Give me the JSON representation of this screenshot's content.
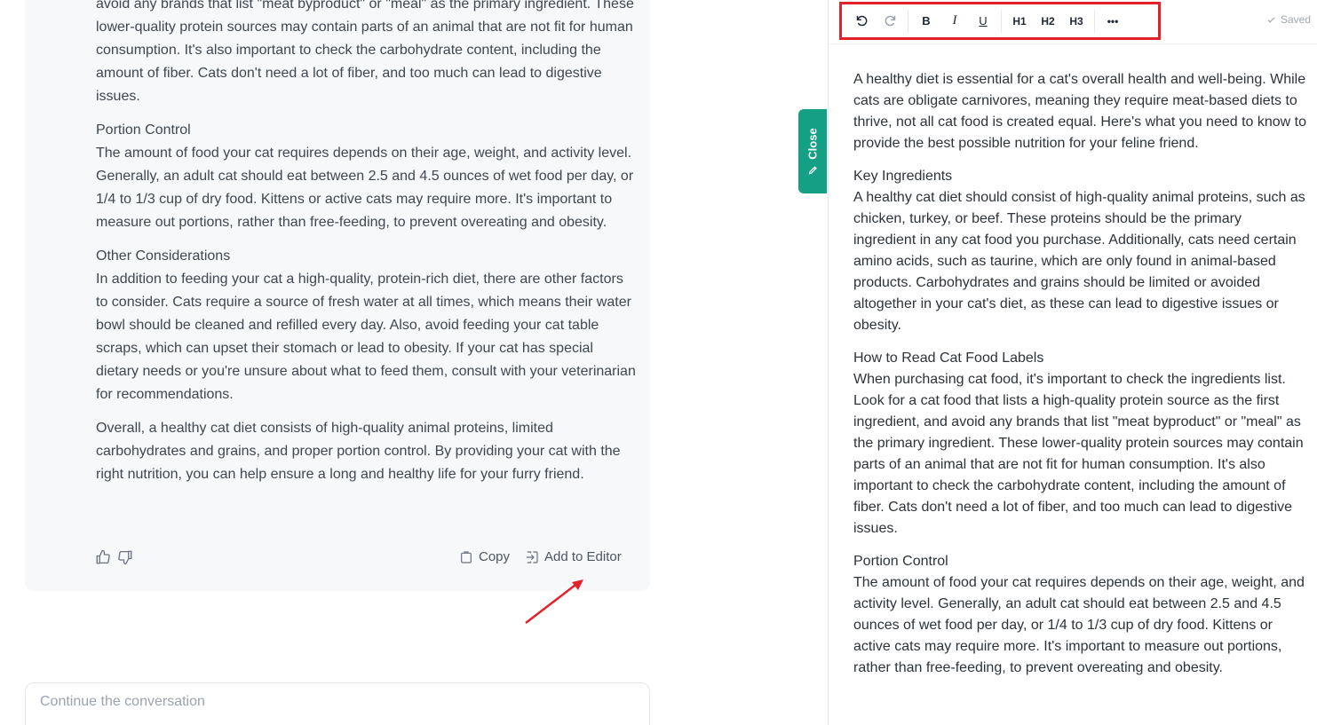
{
  "chat": {
    "paragraphs": [
      {
        "title": "",
        "text": "avoid any brands that list \"meat byproduct\" or \"meal\" as the primary ingredient. These lower-quality protein sources may contain parts of an animal that are not fit for human consumption. It's also important to check the carbohydrate content, including the amount of fiber. Cats don't need a lot of fiber, and too much can lead to digestive issues."
      },
      {
        "title": "Portion Control",
        "text": "The amount of food your cat requires depends on their age, weight, and activity level. Generally, an adult cat should eat between 2.5 and 4.5 ounces of wet food per day, or 1/4 to 1/3 cup of dry food. Kittens or active cats may require more. It's important to measure out portions, rather than free-feeding, to prevent overeating and obesity."
      },
      {
        "title": "Other Considerations",
        "text": "In addition to feeding your cat a high-quality, protein-rich diet, there are other factors to consider. Cats require a source of fresh water at all times, which means their water bowl should be cleaned and refilled every day. Also, avoid feeding your cat table scraps, which can upset their stomach or lead to obesity. If your cat has special dietary needs or you're unsure about what to feed them, consult with your veterinarian for recommendations."
      },
      {
        "title": "",
        "text": "Overall, a healthy cat diet consists of high-quality animal proteins, limited carbohydrates and grains, and proper portion control. By providing your cat with the right nutrition, you can help ensure a long and healthy life for your furry friend."
      }
    ],
    "actions": {
      "copy_label": "Copy",
      "add_to_editor_label": "Add to Editor"
    },
    "composer_placeholder": "Continue the conversation"
  },
  "close_tab": {
    "label": "Close"
  },
  "editor": {
    "toolbar": {
      "bold": "B",
      "italic": "I",
      "underline": "U",
      "h1": "H1",
      "h2": "H2",
      "h3": "H3",
      "more": "•••"
    },
    "saved_label": "Saved",
    "paragraphs": [
      {
        "title": "",
        "text": "A healthy diet is essential for a cat's overall health and well-being. While cats are obligate carnivores, meaning they require meat-based diets to thrive, not all cat food is created equal. Here's what you need to know to provide the best possible nutrition for your feline friend."
      },
      {
        "title": "Key Ingredients",
        "text": "A healthy cat diet should consist of high-quality animal proteins, such as chicken, turkey, or beef. These proteins should be the primary ingredient in any cat food you purchase. Additionally, cats need certain amino acids, such as taurine, which are only found in animal-based products. Carbohydrates and grains should be limited or avoided altogether in your cat's diet, as these can lead to digestive issues or obesity."
      },
      {
        "title": "How to Read Cat Food Labels",
        "text": "When purchasing cat food, it's important to check the ingredients list. Look for a cat food that lists a high-quality protein source as the first ingredient, and avoid any brands that list \"meat byproduct\" or \"meal\" as the primary ingredient. These lower-quality protein sources may contain parts of an animal that are not fit for human consumption. It's also important to check the carbohydrate content, including the amount of fiber. Cats don't need a lot of fiber, and too much can lead to digestive issues."
      },
      {
        "title": "Portion Control",
        "text": "The amount of food your cat requires depends on their age, weight, and activity level. Generally, an adult cat should eat between 2.5 and 4.5 ounces of wet food per day, or 1/4 to 1/3 cup of dry food. Kittens or active cats may require more. It's important to measure out portions, rather than free-feeding, to prevent overeating and obesity."
      }
    ]
  },
  "colors": {
    "accent": "#14a085",
    "highlight": "#e3212b",
    "card_bg": "#f6f8f9"
  }
}
